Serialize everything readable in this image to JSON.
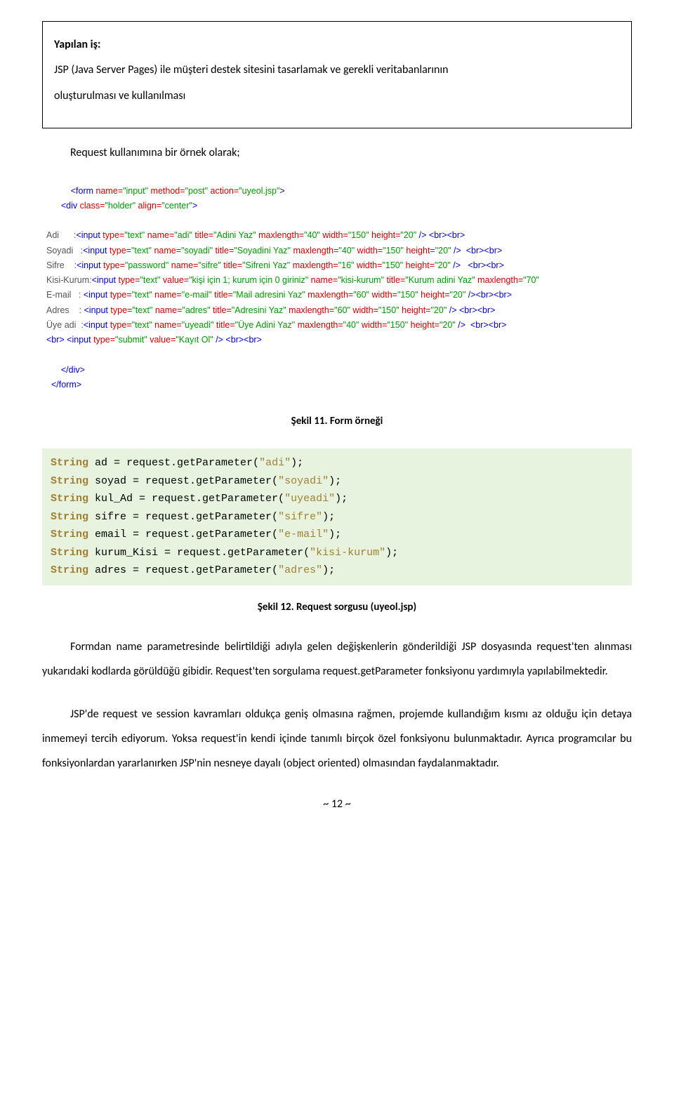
{
  "header": {
    "title": "Yapılan iş:",
    "desc1": "JSP (Java Server Pages) ile müşteri destek sitesini tasarlamak ve gerekli veritabanlarının",
    "desc2": "oluşturulması ve kullanılması"
  },
  "intro": "Request kullanımına bir örnek olarak;",
  "code1": {
    "lines": [
      {
        "indent": "          ",
        "segs": [
          {
            "t": "tag",
            "v": "<form "
          },
          {
            "t": "attr",
            "v": "name="
          },
          {
            "t": "str",
            "v": "\"input\""
          },
          {
            "t": "attr",
            "v": " method="
          },
          {
            "t": "str",
            "v": "\"post\""
          },
          {
            "t": "attr",
            "v": " action="
          },
          {
            "t": "str",
            "v": "\"uyeol.jsp\""
          },
          {
            "t": "tag",
            "v": ">"
          }
        ]
      },
      {
        "indent": "      ",
        "segs": [
          {
            "t": "tag",
            "v": "<div "
          },
          {
            "t": "attr",
            "v": "class="
          },
          {
            "t": "str",
            "v": "\"holder\""
          },
          {
            "t": "attr",
            "v": " align="
          },
          {
            "t": "str",
            "v": "\"center\""
          },
          {
            "t": "tag",
            "v": ">"
          }
        ]
      },
      {
        "indent": "",
        "segs": [
          {
            "t": "plain",
            "v": ""
          }
        ]
      },
      {
        "indent": "",
        "segs": [
          {
            "t": "plain",
            "v": "Adi      :"
          },
          {
            "t": "tag",
            "v": "<input "
          },
          {
            "t": "attr",
            "v": "type="
          },
          {
            "t": "str",
            "v": "\"text\""
          },
          {
            "t": "attr",
            "v": " name="
          },
          {
            "t": "str",
            "v": "\"adi\""
          },
          {
            "t": "attr",
            "v": " title="
          },
          {
            "t": "str",
            "v": "\"Adini Yaz\""
          },
          {
            "t": "attr",
            "v": " maxlength="
          },
          {
            "t": "str",
            "v": "\"40\""
          },
          {
            "t": "attr",
            "v": " width="
          },
          {
            "t": "str",
            "v": "\"150\""
          },
          {
            "t": "attr",
            "v": " height="
          },
          {
            "t": "str",
            "v": "\"20\""
          },
          {
            "t": "tag",
            "v": " /> <br><br>"
          }
        ]
      },
      {
        "indent": "",
        "segs": [
          {
            "t": "plain",
            "v": "Soyadi   :"
          },
          {
            "t": "tag",
            "v": "<input "
          },
          {
            "t": "attr",
            "v": "type="
          },
          {
            "t": "str",
            "v": "\"text\""
          },
          {
            "t": "attr",
            "v": " name="
          },
          {
            "t": "str",
            "v": "\"soyadi\""
          },
          {
            "t": "attr",
            "v": " title="
          },
          {
            "t": "str",
            "v": "\"Soyadini Yaz\""
          },
          {
            "t": "attr",
            "v": " maxlength="
          },
          {
            "t": "str",
            "v": "\"40\""
          },
          {
            "t": "attr",
            "v": " width="
          },
          {
            "t": "str",
            "v": "\"150\""
          },
          {
            "t": "attr",
            "v": " height="
          },
          {
            "t": "str",
            "v": "\"20\""
          },
          {
            "t": "tag",
            "v": " />  <br><br>"
          }
        ]
      },
      {
        "indent": "",
        "segs": [
          {
            "t": "plain",
            "v": "Sifre    :"
          },
          {
            "t": "tag",
            "v": "<input "
          },
          {
            "t": "attr",
            "v": "type="
          },
          {
            "t": "str",
            "v": "\"password\""
          },
          {
            "t": "attr",
            "v": " name="
          },
          {
            "t": "str",
            "v": "\"sifre\""
          },
          {
            "t": "attr",
            "v": " title="
          },
          {
            "t": "str",
            "v": "\"Sifreni Yaz\""
          },
          {
            "t": "attr",
            "v": " maxlength="
          },
          {
            "t": "str",
            "v": "\"16\""
          },
          {
            "t": "attr",
            "v": " width="
          },
          {
            "t": "str",
            "v": "\"150\""
          },
          {
            "t": "attr",
            "v": " height="
          },
          {
            "t": "str",
            "v": "\"20\""
          },
          {
            "t": "tag",
            "v": " />   <br><br>"
          }
        ]
      },
      {
        "indent": "",
        "segs": [
          {
            "t": "plain",
            "v": "Kisi-Kurum:"
          },
          {
            "t": "tag",
            "v": "<input "
          },
          {
            "t": "attr",
            "v": "type="
          },
          {
            "t": "str",
            "v": "\"text\""
          },
          {
            "t": "attr",
            "v": " value="
          },
          {
            "t": "str",
            "v": "\"kişi için 1; kurum için 0 giriniz\""
          },
          {
            "t": "attr",
            "v": " name="
          },
          {
            "t": "str",
            "v": "\"kisi-kurum\""
          },
          {
            "t": "attr",
            "v": " title="
          },
          {
            "t": "str",
            "v": "\"Kurum adini Yaz\""
          },
          {
            "t": "attr",
            "v": " maxlength="
          },
          {
            "t": "str",
            "v": "\"70\""
          }
        ]
      },
      {
        "indent": "",
        "segs": [
          {
            "t": "plain",
            "v": "E-mail   : "
          },
          {
            "t": "tag",
            "v": "<input "
          },
          {
            "t": "attr",
            "v": "type="
          },
          {
            "t": "str",
            "v": "\"text\""
          },
          {
            "t": "attr",
            "v": " name="
          },
          {
            "t": "str",
            "v": "\"e-mail\""
          },
          {
            "t": "attr",
            "v": " title="
          },
          {
            "t": "str",
            "v": "\"Mail adresini Yaz\""
          },
          {
            "t": "attr",
            "v": " maxlength="
          },
          {
            "t": "str",
            "v": "\"60\""
          },
          {
            "t": "attr",
            "v": " width="
          },
          {
            "t": "str",
            "v": "\"150\""
          },
          {
            "t": "attr",
            "v": " height="
          },
          {
            "t": "str",
            "v": "\"20\""
          },
          {
            "t": "tag",
            "v": " /><br><br>"
          }
        ]
      },
      {
        "indent": "",
        "segs": [
          {
            "t": "plain",
            "v": "Adres    : "
          },
          {
            "t": "tag",
            "v": "<input "
          },
          {
            "t": "attr",
            "v": "type="
          },
          {
            "t": "str",
            "v": "\"text\""
          },
          {
            "t": "attr",
            "v": " name="
          },
          {
            "t": "str",
            "v": "\"adres\""
          },
          {
            "t": "attr",
            "v": " title="
          },
          {
            "t": "str",
            "v": "\"Adresini Yaz\""
          },
          {
            "t": "attr",
            "v": " maxlength="
          },
          {
            "t": "str",
            "v": "\"60\""
          },
          {
            "t": "attr",
            "v": " width="
          },
          {
            "t": "str",
            "v": "\"150\""
          },
          {
            "t": "attr",
            "v": " height="
          },
          {
            "t": "str",
            "v": "\"20\""
          },
          {
            "t": "tag",
            "v": " /> <br><br>"
          }
        ]
      },
      {
        "indent": "",
        "segs": [
          {
            "t": "plain",
            "v": "Üye adi  :"
          },
          {
            "t": "tag",
            "v": "<input "
          },
          {
            "t": "attr",
            "v": "type="
          },
          {
            "t": "str",
            "v": "\"text\""
          },
          {
            "t": "attr",
            "v": " name="
          },
          {
            "t": "str",
            "v": "\"uyeadi\""
          },
          {
            "t": "attr",
            "v": " title="
          },
          {
            "t": "str",
            "v": "\"Üye Adini Yaz\""
          },
          {
            "t": "attr",
            "v": " maxlength="
          },
          {
            "t": "str",
            "v": "\"40\""
          },
          {
            "t": "attr",
            "v": " width="
          },
          {
            "t": "str",
            "v": "\"150\""
          },
          {
            "t": "attr",
            "v": " height="
          },
          {
            "t": "str",
            "v": "\"20\""
          },
          {
            "t": "tag",
            "v": " />  <br><br>"
          }
        ]
      },
      {
        "indent": "",
        "segs": [
          {
            "t": "tag",
            "v": "<br> <input "
          },
          {
            "t": "attr",
            "v": "type="
          },
          {
            "t": "str",
            "v": "\"submit\""
          },
          {
            "t": "attr",
            "v": " value="
          },
          {
            "t": "str",
            "v": "\"Kayıt Ol\""
          },
          {
            "t": "tag",
            "v": " /> <br><br>"
          }
        ]
      },
      {
        "indent": "",
        "segs": [
          {
            "t": "plain",
            "v": ""
          }
        ]
      },
      {
        "indent": "      ",
        "segs": [
          {
            "t": "tag",
            "v": "</div>"
          }
        ]
      },
      {
        "indent": "  ",
        "segs": [
          {
            "t": "tag",
            "v": "</form>"
          }
        ]
      }
    ]
  },
  "caption1": "Şekil 11. Form örneği",
  "code2": {
    "lines": [
      {
        "var": "ad",
        "param": "\"adi\""
      },
      {
        "var": "soyad",
        "param": "\"soyadi\""
      },
      {
        "var": "kul_Ad",
        "param": "\"uyeadi\""
      },
      {
        "var": "sifre",
        "param": "\"sifre\""
      },
      {
        "var": "email",
        "param": "\"e-mail\""
      },
      {
        "var": "kurum_Kisi",
        "param": "\"kisi-kurum\""
      },
      {
        "var": "adres",
        "param": "\"adres\""
      }
    ]
  },
  "caption2": "Şekil 12. Request sorgusu (uyeol.jsp)",
  "body": {
    "p1": "Formdan name parametresinde belirtildiği adıyla gelen değişkenlerin gönderildiği JSP dosyasında request'ten alınması yukarıdaki kodlarda görüldüğü gibidir. Request'ten sorgulama request.getParameter fonksiyonu yardımıyla yapılabilmektedir.",
    "p2": "JSP'de request ve session kavramları oldukça geniş olmasına rağmen, projemde kullandığım kısmı az olduğu için detaya inmemeyi tercih ediyorum. Yoksa request'in kendi içinde tanımlı birçok özel fonksiyonu bulunmaktadır. Ayrıca programcılar bu fonksiyonlardan yararlanırken JSP'nin nesneye dayalı (object oriented) olmasından faydalanmaktadır."
  },
  "pagenum": "~ 12 ~"
}
